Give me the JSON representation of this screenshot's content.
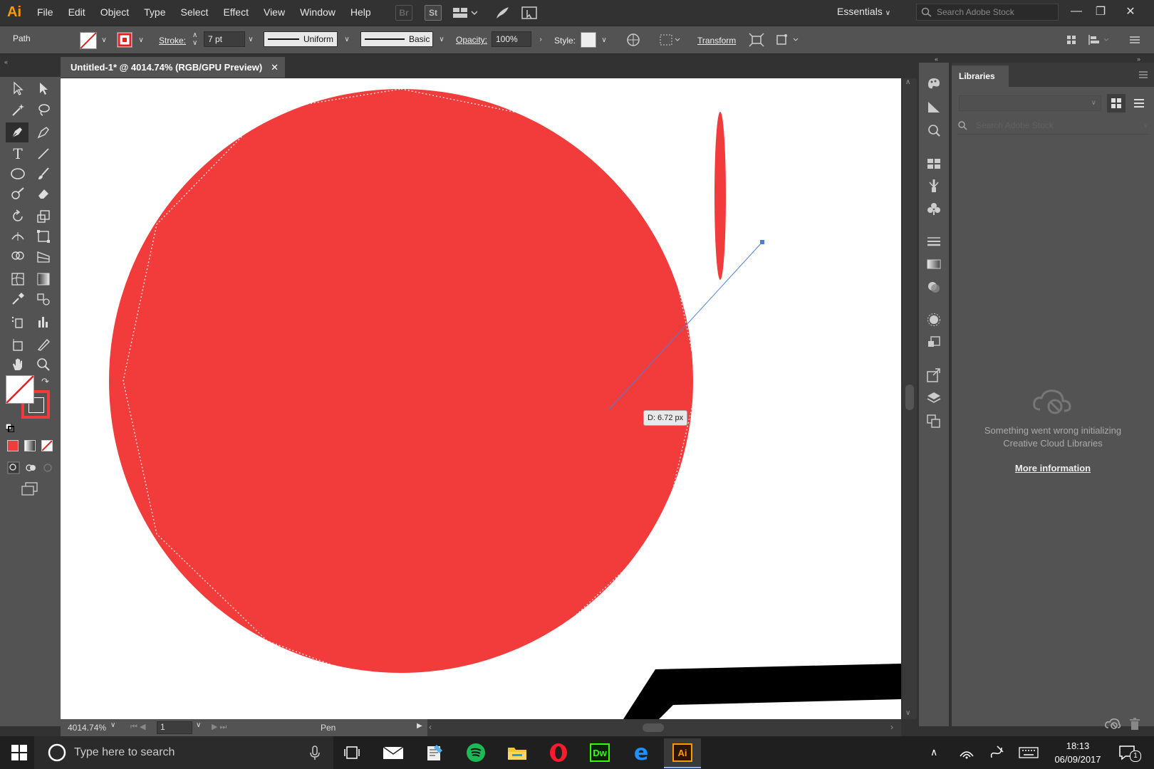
{
  "app": {
    "logo": "Ai",
    "menu": [
      "File",
      "Edit",
      "Object",
      "Type",
      "Select",
      "Effect",
      "View",
      "Window",
      "Help"
    ],
    "bridge_label": "Br",
    "stock_label": "St",
    "workspace": "Essentials",
    "stock_search_placeholder": "Search Adobe Stock"
  },
  "control_bar": {
    "selection_type": "Path",
    "stroke_label": "Stroke:",
    "stroke_weight": "7 pt",
    "profile_label": "Uniform",
    "brush_label": "Basic",
    "opacity_label": "Opacity:",
    "opacity_value": "100%",
    "style_label": "Style:",
    "transform_label": "Transform"
  },
  "document": {
    "tab_title": "Untitled-1* @ 4014.74% (RGB/GPU Preview)"
  },
  "canvas": {
    "tooltip": "D: 6.72 px",
    "colors": {
      "fill": "#f23c3c",
      "guide": "#4a7fd9",
      "shape_black": "#000000"
    }
  },
  "libraries": {
    "tab_label": "Libraries",
    "search_placeholder": "Search Adobe Stock",
    "error_message_line1": "Something went wrong initializing",
    "error_message_line2": "Creative Cloud Libraries",
    "more_info_link": "More information"
  },
  "status_bar": {
    "zoom": "4014.74%",
    "artboard": "1",
    "tool": "Pen"
  },
  "taskbar": {
    "search_placeholder": "Type here to search",
    "time": "18:13",
    "date": "06/09/2017",
    "notification_count": "1",
    "apps": [
      "task-view",
      "mail",
      "notepad",
      "spotify",
      "file-explorer",
      "opera",
      "dreamweaver",
      "edge",
      "illustrator"
    ],
    "dw_label": "Dw",
    "ai_label": "Ai"
  }
}
